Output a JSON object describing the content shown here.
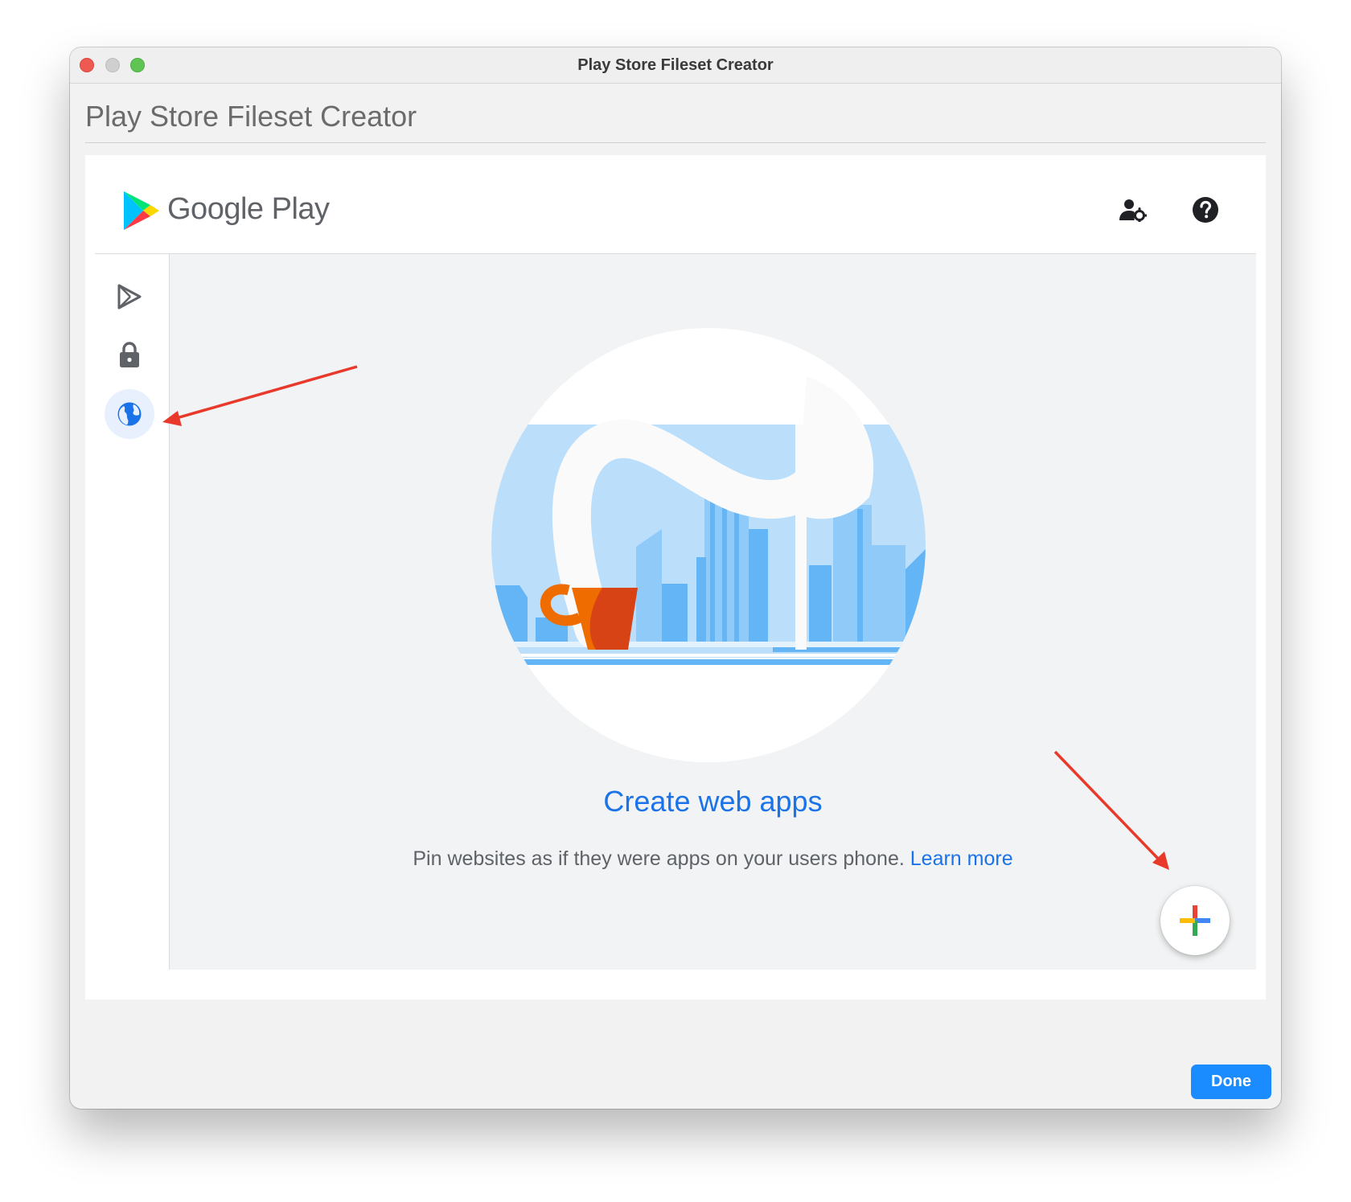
{
  "window": {
    "title": "Play Store Fileset Creator"
  },
  "dialog": {
    "title": "Play Store Fileset Creator",
    "done_label": "Done"
  },
  "header": {
    "brand": "Google Play",
    "icons": [
      "admin-settings-icon",
      "help-icon"
    ]
  },
  "sidebar": {
    "items": [
      {
        "name": "apps",
        "icon": "play-icon",
        "active": false
      },
      {
        "name": "security",
        "icon": "lock-icon",
        "active": false
      },
      {
        "name": "web-apps",
        "icon": "globe-icon",
        "active": true
      }
    ]
  },
  "empty_state": {
    "title": "Create web apps",
    "description": "Pin websites as if they were apps on your users phone.",
    "link": "Learn more"
  },
  "fab": {
    "icon": "plus-icon"
  },
  "colors": {
    "accent": "#1a73e8",
    "done_button": "#1a8cff",
    "annotation_arrow": "#e8392b"
  }
}
